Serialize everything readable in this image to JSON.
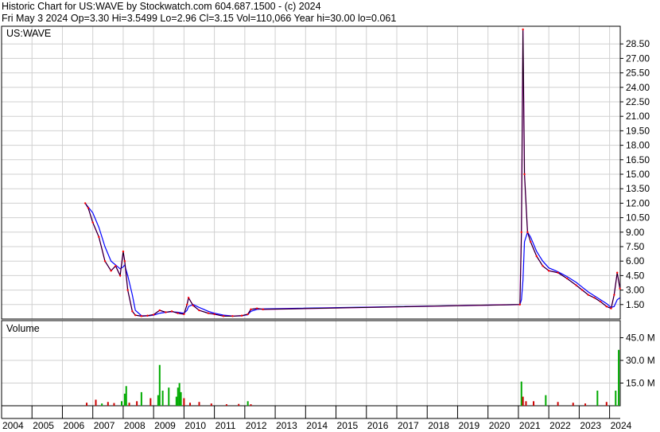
{
  "header": {
    "line1": "Historic Chart for US:WAVE by Stockwatch.com 604.687.1500 - (c) 2024",
    "line2": "Fri May  3 2024   Op=3.30   Hi=3.5499   Lo=2.96   Cl=3.15   Vol=110,066   Year hi=30.00   lo=0.061"
  },
  "colors": {
    "price": "#000000",
    "ma_short": "#ff0000",
    "ma_mid": "#ff00ff",
    "ma_long": "#0000ff",
    "vol_up": "#00aa00",
    "vol_down": "#cc0000",
    "grid": "#d0d0d0",
    "frame": "#000000"
  },
  "chart_data": [
    {
      "type": "line",
      "label": "US:WAVE",
      "x": [
        2006.75,
        2006.85,
        2007.0,
        2007.2,
        2007.4,
        2007.6,
        2007.75,
        2007.9,
        2008.0,
        2008.05,
        2008.15,
        2008.3,
        2008.4,
        2008.6,
        2008.8,
        2009.0,
        2009.2,
        2009.4,
        2009.6,
        2009.8,
        2010.0,
        2010.1,
        2010.15,
        2010.3,
        2010.5,
        2010.8,
        2011.0,
        2011.3,
        2011.6,
        2011.9,
        2012.1,
        2012.2,
        2012.4,
        2012.6,
        2021.05,
        2021.1,
        2021.15,
        2021.2,
        2021.3,
        2021.4,
        2021.6,
        2021.8,
        2022.0,
        2022.3,
        2022.6,
        2022.9,
        2023.1,
        2023.3,
        2023.5,
        2023.7,
        2023.9,
        2024.05,
        2024.15,
        2024.25,
        2024.34
      ],
      "y": [
        12.0,
        11.5,
        10.0,
        8.5,
        6.0,
        5.0,
        5.5,
        4.5,
        7.0,
        6.0,
        3.0,
        0.8,
        0.4,
        0.3,
        0.35,
        0.45,
        0.9,
        0.7,
        0.8,
        0.6,
        0.5,
        1.5,
        2.2,
        1.4,
        0.9,
        0.6,
        0.5,
        0.3,
        0.3,
        0.35,
        0.5,
        1.0,
        1.1,
        1.0,
        1.5,
        9.0,
        30.0,
        15.0,
        9.0,
        8.0,
        6.5,
        5.5,
        5.0,
        4.8,
        4.2,
        3.5,
        3.0,
        2.5,
        2.2,
        1.8,
        1.3,
        1.1,
        2.5,
        4.8,
        3.15
      ],
      "ma_long_y": [
        12.0,
        11.6,
        11.0,
        9.5,
        7.5,
        6.0,
        5.6,
        5.2,
        5.4,
        5.6,
        4.5,
        2.5,
        0.9,
        0.35,
        0.32,
        0.4,
        0.6,
        0.7,
        0.75,
        0.7,
        0.6,
        0.9,
        1.3,
        1.5,
        1.2,
        0.8,
        0.6,
        0.4,
        0.32,
        0.33,
        0.45,
        0.8,
        1.0,
        1.05,
        1.5,
        2.0,
        4.0,
        8.0,
        9.0,
        8.5,
        7.0,
        6.0,
        5.3,
        4.9,
        4.4,
        3.8,
        3.3,
        2.8,
        2.4,
        2.0,
        1.6,
        1.2,
        1.3,
        2.0,
        2.2
      ],
      "xlim": [
        2004.0,
        2024.35
      ],
      "ylim": [
        0,
        30.0
      ],
      "y_ticks": [
        "1.50",
        "3.00",
        "4.50",
        "6.00",
        "7.50",
        "9.00",
        "10.50",
        "12.00",
        "13.50",
        "15.00",
        "16.50",
        "18.00",
        "19.50",
        "21.00",
        "22.50",
        "24.00",
        "25.50",
        "27.00",
        "28.50"
      ],
      "x_ticks": [
        "2004",
        "2005",
        "2006",
        "2007",
        "2008",
        "2009",
        "2010",
        "2011",
        "2012",
        "2013",
        "2014",
        "2015",
        "2016",
        "2017",
        "2018",
        "2019",
        "2020",
        "2021",
        "2022",
        "2023",
        "2024"
      ],
      "grid": true
    },
    {
      "type": "bar",
      "label": "Volume",
      "unit": "M",
      "x": [
        2006.8,
        2007.1,
        2007.3,
        2007.5,
        2007.7,
        2007.95,
        2008.05,
        2008.1,
        2008.2,
        2008.45,
        2008.6,
        2008.9,
        2009.15,
        2009.2,
        2009.3,
        2009.5,
        2009.75,
        2009.8,
        2009.85,
        2009.9,
        2010.0,
        2010.2,
        2010.5,
        2010.9,
        2011.4,
        2011.8,
        2012.1,
        2012.2,
        2021.1,
        2021.15,
        2021.25,
        2021.5,
        2021.9,
        2022.3,
        2022.8,
        2023.2,
        2023.6,
        2023.9,
        2024.2,
        2024.3
      ],
      "values": [
        2.0,
        4.0,
        1.5,
        2.5,
        1.8,
        3.0,
        8.0,
        13.0,
        2.0,
        3.0,
        9.0,
        5.0,
        7.0,
        27.0,
        10.0,
        12.0,
        6.0,
        12.0,
        15.0,
        9.0,
        5.0,
        2.0,
        2.5,
        1.5,
        1.0,
        1.2,
        3.0,
        1.0,
        16.0,
        6.0,
        3.0,
        3.0,
        7.0,
        2.5,
        2.0,
        1.5,
        10.0,
        2.5,
        10.0,
        37.0
      ],
      "up": [
        false,
        false,
        true,
        false,
        false,
        true,
        true,
        true,
        false,
        false,
        true,
        false,
        true,
        true,
        true,
        true,
        true,
        true,
        true,
        true,
        false,
        false,
        false,
        false,
        false,
        false,
        true,
        false,
        true,
        false,
        false,
        false,
        true,
        false,
        false,
        false,
        true,
        false,
        true,
        true
      ],
      "ylim": [
        0,
        50
      ],
      "y_ticks": [
        "15.0 M",
        "30.0 M",
        "45.0 M"
      ]
    }
  ]
}
